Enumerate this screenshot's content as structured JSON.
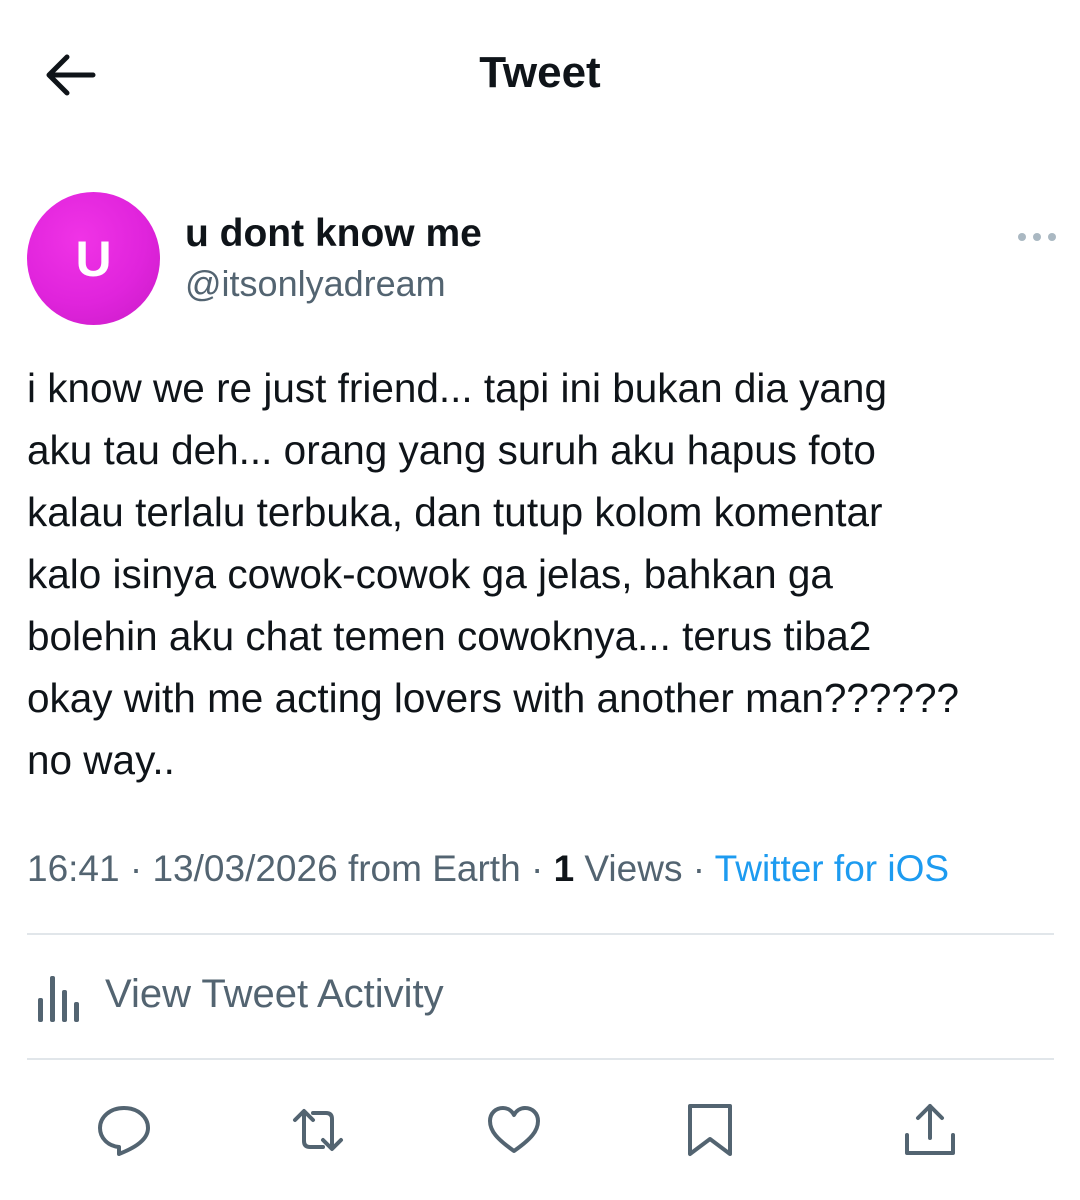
{
  "header": {
    "title": "Tweet",
    "back_icon": "arrow-left-icon"
  },
  "tweet": {
    "author": {
      "display_name": "u dont know me",
      "handle": "@itsonlyadream",
      "avatar_initial": "U",
      "avatar_color": "#e024dc"
    },
    "text": "i know we re just friend... tapi ini bukan dia yang\naku tau deh... orang yang suruh aku hapus foto\nkalau terlalu terbuka, dan tutup kolom komentar\nkalo isinya cowok-cowok ga jelas, bahkan ga\nbolehin aku chat temen cowoknya... terus tiba2\nokay with me acting lovers with another man??????\nno way..",
    "meta": {
      "time": "16:41",
      "separator": " · ",
      "date_location": "13/03/2026 from Earth",
      "views_count": "1",
      "views_label": " Views",
      "source": "Twitter for iOS"
    }
  },
  "activity": {
    "label": "View Tweet Activity",
    "icon": "bar-chart-icon"
  },
  "actions": [
    {
      "name": "reply-button",
      "icon": "speech-bubble-icon"
    },
    {
      "name": "retweet-button",
      "icon": "retweet-icon"
    },
    {
      "name": "like-button",
      "icon": "heart-icon"
    },
    {
      "name": "bookmark-button",
      "icon": "bookmark-icon"
    },
    {
      "name": "share-button",
      "icon": "share-icon"
    }
  ],
  "colors": {
    "accent": "#1d9bf0",
    "secondary_text": "#536471",
    "primary_text": "#0f1419",
    "divider": "#e1e6ea"
  }
}
